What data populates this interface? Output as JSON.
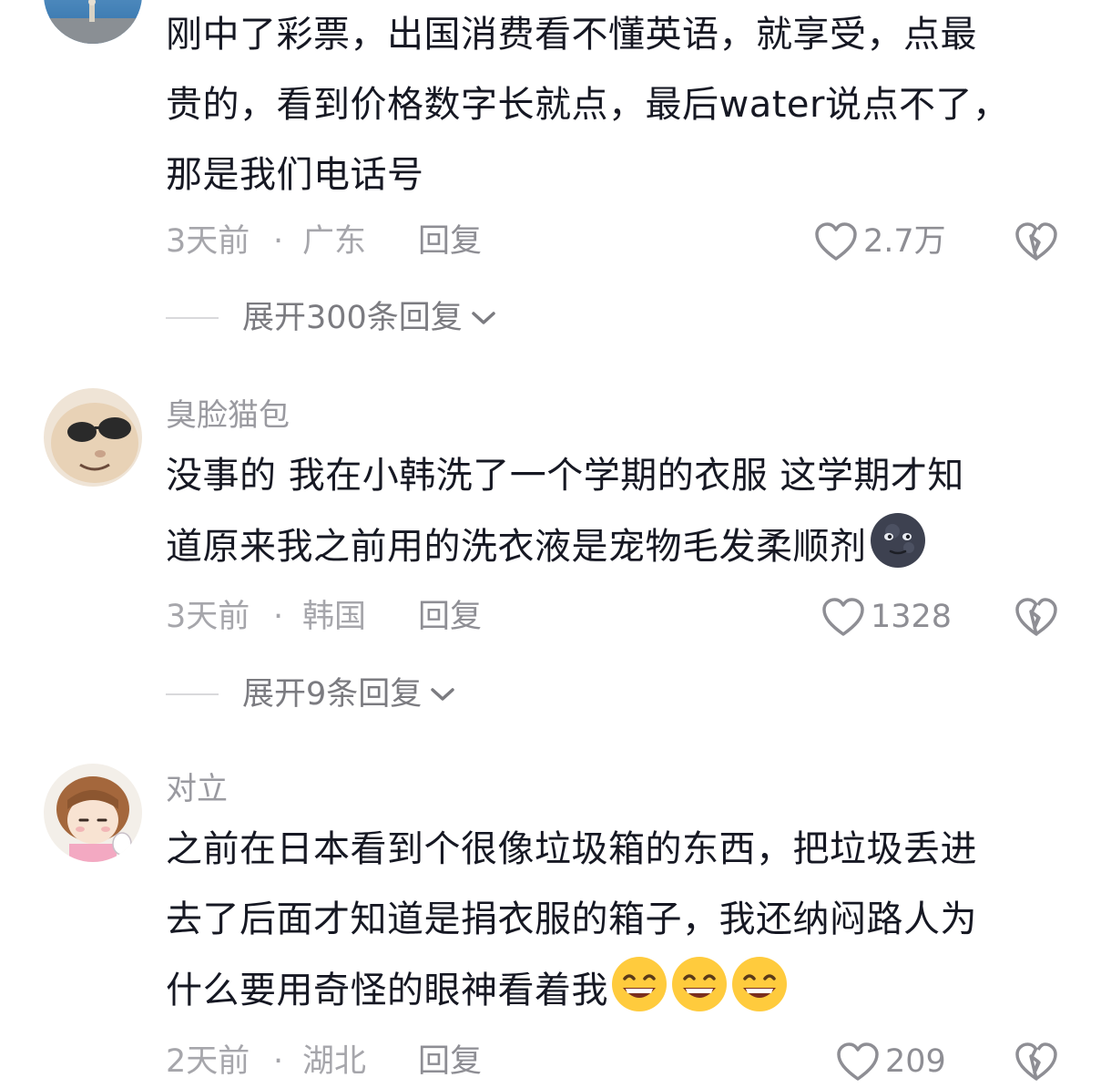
{
  "comments": [
    {
      "username": "",
      "lines": [
        "刚中了彩票，出国消费看不懂英语，就享受，点最",
        "贵的，看到价格数字长就点，最后water说点不了，",
        "那是我们电话号"
      ],
      "emojis": [],
      "time": "3天前",
      "separator": "·",
      "region": "广东",
      "reply_label": "回复",
      "like_count": "2.7万",
      "expand_label": "展开300条回复"
    },
    {
      "username": "臭脸猫包",
      "lines": [
        "没事的 我在小韩洗了一个学期的衣服 这学期才知",
        "道原来我之前用的洗衣液是宠物毛发柔顺剂"
      ],
      "emojis": [
        "new-moon-face-emoji"
      ],
      "time": "3天前",
      "separator": "·",
      "region": "韩国",
      "reply_label": "回复",
      "like_count": "1328",
      "expand_label": "展开9条回复"
    },
    {
      "username": "对立",
      "lines": [
        "之前在日本看到个很像垃圾箱的东西，把垃圾丢进",
        "去了后面才知道是捐衣服的箱子，我还纳闷路人为",
        "什么要用奇怪的眼神看着我"
      ],
      "emojis": [
        "grinning-face-emoji",
        "grinning-face-emoji",
        "grinning-face-emoji"
      ],
      "time": "2天前",
      "separator": "·",
      "region": "湖北",
      "reply_label": "回复",
      "like_count": "209",
      "expand_label": ""
    }
  ],
  "icons": {
    "like": "heart-outline-icon",
    "dislike": "broken-heart-icon",
    "expand": "chevron-down-icon"
  },
  "colors": {
    "text": "#161823",
    "meta": "#a6a6ab",
    "username": "#9a9aa0"
  }
}
